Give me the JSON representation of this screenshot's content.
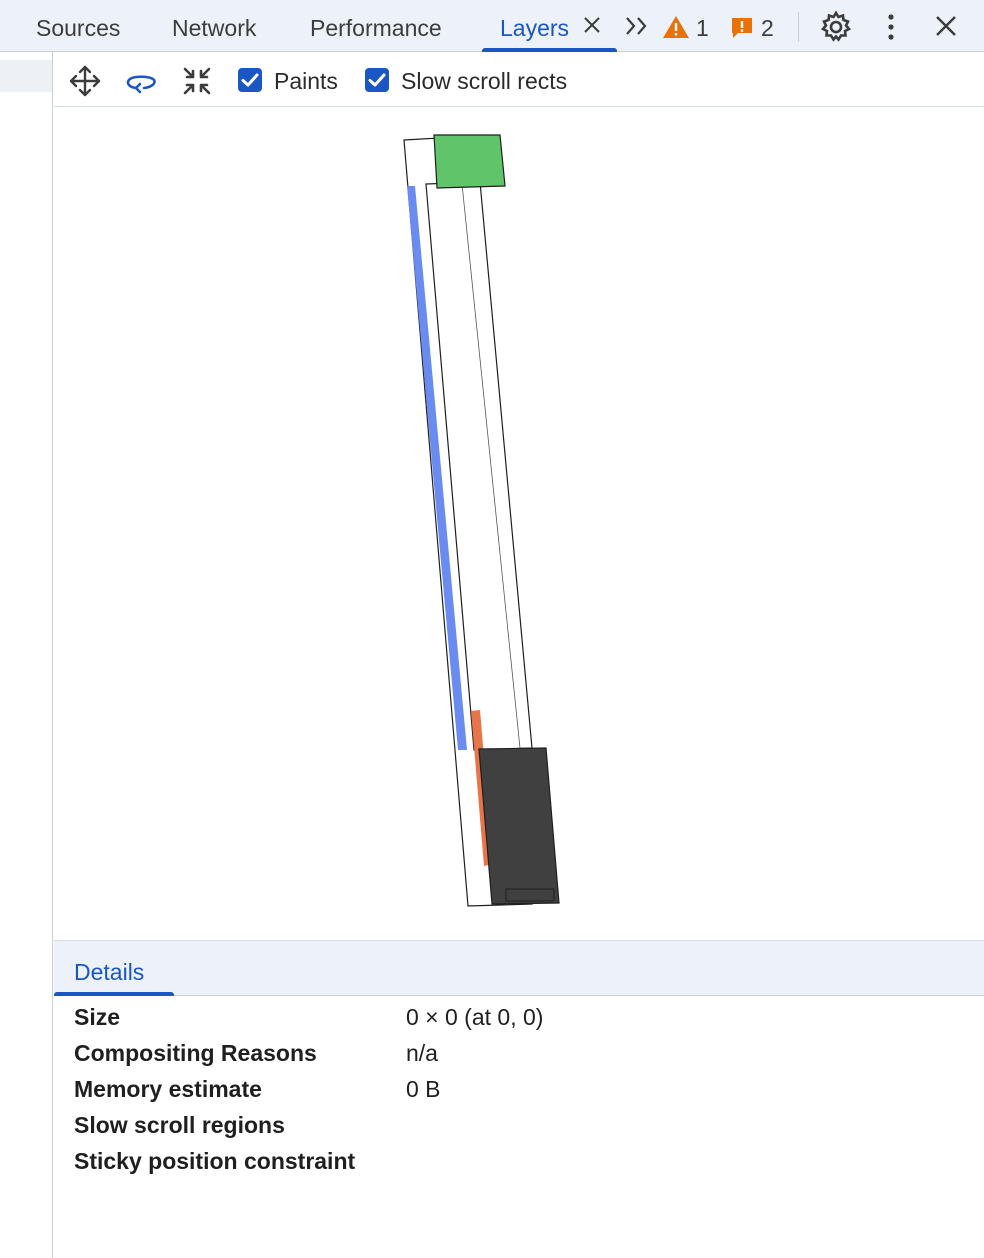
{
  "tabs": [
    {
      "label": "Sources"
    },
    {
      "label": "Network"
    },
    {
      "label": "Performance"
    },
    {
      "label": "Layers",
      "active": true
    }
  ],
  "status": {
    "warnings": "1",
    "errors": "2",
    "warning_color": "#e8710a",
    "error_color": "#e8710a"
  },
  "toolbar": {
    "paints_label": "Paints",
    "paints_checked": true,
    "slow_scroll_label": "Slow scroll rects",
    "slow_scroll_checked": true
  },
  "layers_view": {
    "layer_colors": {
      "paint_green": "#5fc46a",
      "scroll_blue": "#6a8cf0",
      "orange": "#e8754a",
      "dark": "#404040"
    }
  },
  "details": {
    "tab_label": "Details",
    "rows": [
      {
        "key": "Size",
        "value": "0 × 0 (at 0, 0)"
      },
      {
        "key": "Compositing Reasons",
        "value": "n/a"
      },
      {
        "key": "Memory estimate",
        "value": "0 B"
      },
      {
        "key": "Slow scroll regions",
        "value": ""
      },
      {
        "key": "Sticky position constraint",
        "value": ""
      }
    ]
  }
}
